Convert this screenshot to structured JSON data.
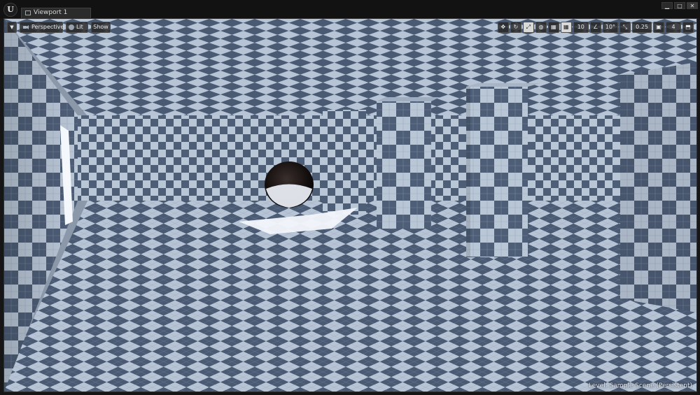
{
  "app": {
    "logo_glyph": "U",
    "logo_icon": "unreal-engine-logo"
  },
  "tab": {
    "label": "Viewport 1",
    "icon": "viewport-tab-icon"
  },
  "window_buttons": {
    "minimize": "▁",
    "maximize": "□",
    "close": "✕"
  },
  "toolbar_left": {
    "menu_glyph": "▼",
    "perspective": "Perspective",
    "lit": "Lit",
    "show": "Show"
  },
  "toolbar_right": {
    "translate_icon": "✥",
    "rotate_icon": "↻",
    "scale_icon": "⤢",
    "world_icon": "◍",
    "surface_snap_icon": "▦",
    "grid_snap_icon": "▦",
    "grid_snap_value": "10",
    "rotate_snap_icon": "∠",
    "rotate_snap_value": "10°",
    "scale_snap_icon": "⤡",
    "scale_snap_value": "0.25",
    "camera_speed_icon": "▣",
    "camera_speed_value": "4",
    "maximize_icon": "⬒"
  },
  "status": {
    "level_label": "Level:  Sample Scene (Persistent)"
  },
  "colors": {
    "checker_light": "#b7c4d5",
    "checker_dark": "#4d5d76",
    "window_bg": "#161616",
    "toolbar_bg": "#262626"
  }
}
